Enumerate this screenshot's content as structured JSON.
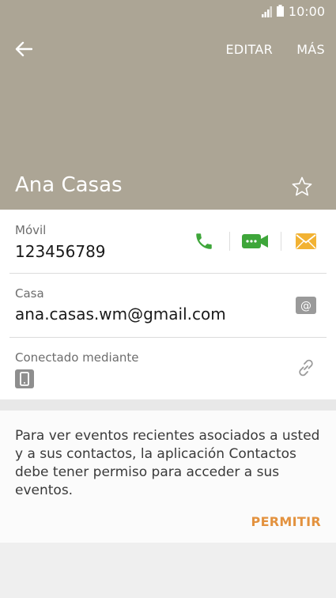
{
  "status_bar": {
    "time": "10:00"
  },
  "toolbar": {
    "edit_label": "EDITAR",
    "more_label": "MÁS",
    "back_icon": "arrow-left-icon"
  },
  "contact": {
    "name": "Ana Casas",
    "favorite_icon": "star-outline-icon"
  },
  "details": {
    "phone": {
      "label": "Móvil",
      "value": "123456789",
      "icons": [
        "call-icon",
        "video-call-icon",
        "message-icon"
      ]
    },
    "email": {
      "label": "Casa",
      "value": "ana.casas.wm@gmail.com",
      "icon": "email-icon"
    },
    "linked": {
      "label": "Conectado mediante",
      "icons": [
        "device-icon",
        "link-icon"
      ]
    }
  },
  "permission": {
    "text": "Para ver eventos recientes asociados a usted y a sus contactos, la aplicación Contactos debe tener permiso para acceder a sus eventos.",
    "allow_label": "PERMITIR"
  },
  "colors": {
    "header_bg": "#aca595",
    "call_green": "#3ea63a",
    "video_green": "#3ea63a",
    "message_orange": "#f2b233",
    "accent_orange": "#e3923f",
    "icon_gray": "#9a9a9a"
  }
}
